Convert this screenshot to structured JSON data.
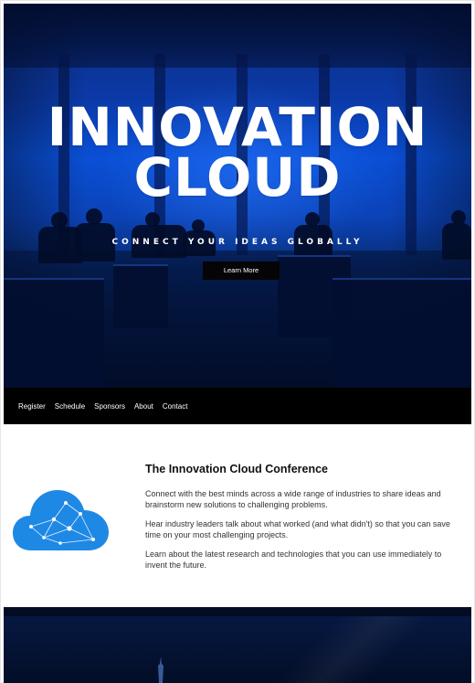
{
  "hero": {
    "title_line1": "INNOVATION",
    "title_line2": "CLOUD",
    "tagline": "CONNECT YOUR IDEAS GLOBALLY",
    "cta_label": "Learn More"
  },
  "nav": {
    "items": [
      "Register",
      "Schedule",
      "Sponsors",
      "About",
      "Contact"
    ]
  },
  "intro": {
    "heading": "The Innovation Cloud Conference",
    "paragraphs": [
      "Connect with the best minds across a wide range of industries to share ideas and brainstorm new solutions to challenging problems.",
      "Hear industry leaders talk about what worked (and what didn't) so that you can save time on your most challenging projects.",
      "Learn about the latest research and technologies that you can use immediately to invent the future."
    ],
    "icon": "cloud-network-icon"
  },
  "colors": {
    "hero_blue": "#0a4fd6",
    "nav_bg": "#000000",
    "cloud_blue": "#1e88e5",
    "footer_bg": "#041233"
  }
}
